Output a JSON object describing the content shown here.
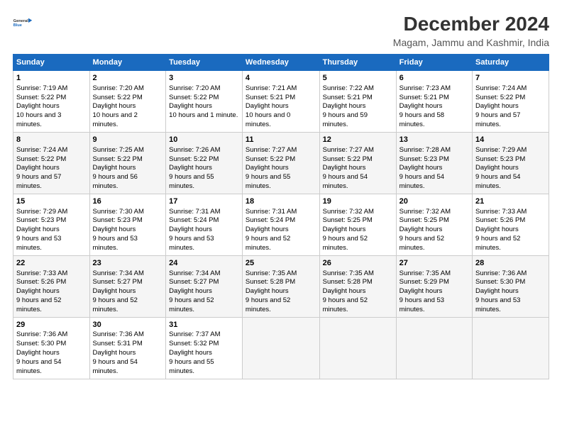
{
  "logo": {
    "line1": "General",
    "line2": "Blue"
  },
  "title": "December 2024",
  "subtitle": "Magam, Jammu and Kashmir, India",
  "weekdays": [
    "Sunday",
    "Monday",
    "Tuesday",
    "Wednesday",
    "Thursday",
    "Friday",
    "Saturday"
  ],
  "weeks": [
    [
      {
        "day": "1",
        "sunrise": "7:19 AM",
        "sunset": "5:22 PM",
        "daylight": "10 hours and 3 minutes."
      },
      {
        "day": "2",
        "sunrise": "7:20 AM",
        "sunset": "5:22 PM",
        "daylight": "10 hours and 2 minutes."
      },
      {
        "day": "3",
        "sunrise": "7:20 AM",
        "sunset": "5:22 PM",
        "daylight": "10 hours and 1 minute."
      },
      {
        "day": "4",
        "sunrise": "7:21 AM",
        "sunset": "5:21 PM",
        "daylight": "10 hours and 0 minutes."
      },
      {
        "day": "5",
        "sunrise": "7:22 AM",
        "sunset": "5:21 PM",
        "daylight": "9 hours and 59 minutes."
      },
      {
        "day": "6",
        "sunrise": "7:23 AM",
        "sunset": "5:21 PM",
        "daylight": "9 hours and 58 minutes."
      },
      {
        "day": "7",
        "sunrise": "7:24 AM",
        "sunset": "5:22 PM",
        "daylight": "9 hours and 57 minutes."
      }
    ],
    [
      {
        "day": "8",
        "sunrise": "7:24 AM",
        "sunset": "5:22 PM",
        "daylight": "9 hours and 57 minutes."
      },
      {
        "day": "9",
        "sunrise": "7:25 AM",
        "sunset": "5:22 PM",
        "daylight": "9 hours and 56 minutes."
      },
      {
        "day": "10",
        "sunrise": "7:26 AM",
        "sunset": "5:22 PM",
        "daylight": "9 hours and 55 minutes."
      },
      {
        "day": "11",
        "sunrise": "7:27 AM",
        "sunset": "5:22 PM",
        "daylight": "9 hours and 55 minutes."
      },
      {
        "day": "12",
        "sunrise": "7:27 AM",
        "sunset": "5:22 PM",
        "daylight": "9 hours and 54 minutes."
      },
      {
        "day": "13",
        "sunrise": "7:28 AM",
        "sunset": "5:23 PM",
        "daylight": "9 hours and 54 minutes."
      },
      {
        "day": "14",
        "sunrise": "7:29 AM",
        "sunset": "5:23 PM",
        "daylight": "9 hours and 54 minutes."
      }
    ],
    [
      {
        "day": "15",
        "sunrise": "7:29 AM",
        "sunset": "5:23 PM",
        "daylight": "9 hours and 53 minutes."
      },
      {
        "day": "16",
        "sunrise": "7:30 AM",
        "sunset": "5:23 PM",
        "daylight": "9 hours and 53 minutes."
      },
      {
        "day": "17",
        "sunrise": "7:31 AM",
        "sunset": "5:24 PM",
        "daylight": "9 hours and 53 minutes."
      },
      {
        "day": "18",
        "sunrise": "7:31 AM",
        "sunset": "5:24 PM",
        "daylight": "9 hours and 52 minutes."
      },
      {
        "day": "19",
        "sunrise": "7:32 AM",
        "sunset": "5:25 PM",
        "daylight": "9 hours and 52 minutes."
      },
      {
        "day": "20",
        "sunrise": "7:32 AM",
        "sunset": "5:25 PM",
        "daylight": "9 hours and 52 minutes."
      },
      {
        "day": "21",
        "sunrise": "7:33 AM",
        "sunset": "5:26 PM",
        "daylight": "9 hours and 52 minutes."
      }
    ],
    [
      {
        "day": "22",
        "sunrise": "7:33 AM",
        "sunset": "5:26 PM",
        "daylight": "9 hours and 52 minutes."
      },
      {
        "day": "23",
        "sunrise": "7:34 AM",
        "sunset": "5:27 PM",
        "daylight": "9 hours and 52 minutes."
      },
      {
        "day": "24",
        "sunrise": "7:34 AM",
        "sunset": "5:27 PM",
        "daylight": "9 hours and 52 minutes."
      },
      {
        "day": "25",
        "sunrise": "7:35 AM",
        "sunset": "5:28 PM",
        "daylight": "9 hours and 52 minutes."
      },
      {
        "day": "26",
        "sunrise": "7:35 AM",
        "sunset": "5:28 PM",
        "daylight": "9 hours and 52 minutes."
      },
      {
        "day": "27",
        "sunrise": "7:35 AM",
        "sunset": "5:29 PM",
        "daylight": "9 hours and 53 minutes."
      },
      {
        "day": "28",
        "sunrise": "7:36 AM",
        "sunset": "5:30 PM",
        "daylight": "9 hours and 53 minutes."
      }
    ],
    [
      {
        "day": "29",
        "sunrise": "7:36 AM",
        "sunset": "5:30 PM",
        "daylight": "9 hours and 54 minutes."
      },
      {
        "day": "30",
        "sunrise": "7:36 AM",
        "sunset": "5:31 PM",
        "daylight": "9 hours and 54 minutes."
      },
      {
        "day": "31",
        "sunrise": "7:37 AM",
        "sunset": "5:32 PM",
        "daylight": "9 hours and 55 minutes."
      },
      null,
      null,
      null,
      null
    ]
  ],
  "labels": {
    "sunrise": "Sunrise:",
    "sunset": "Sunset:",
    "daylight": "Daylight hours"
  }
}
